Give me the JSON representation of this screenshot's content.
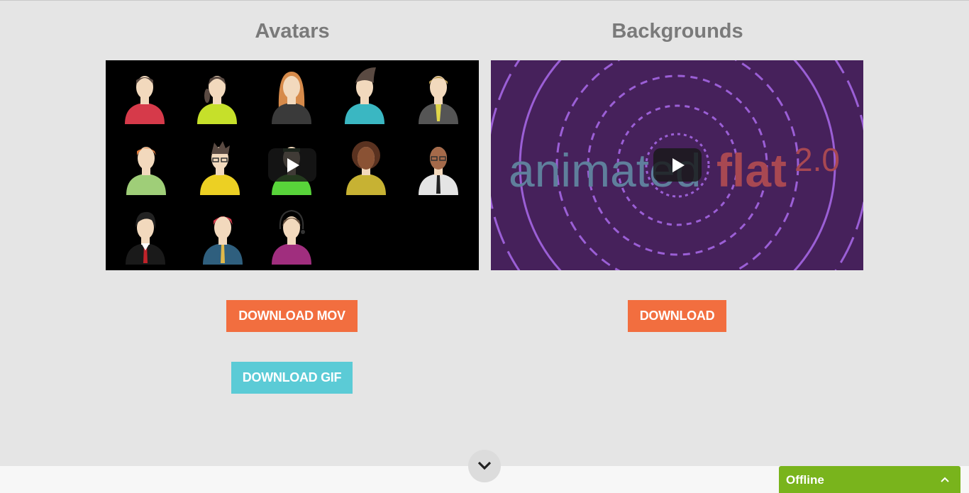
{
  "sections": [
    {
      "title": "Avatars",
      "buttons": [
        {
          "label": "DOWNLOAD MOV",
          "color": "#f26e3f"
        },
        {
          "label": "DOWNLOAD GIF",
          "color": "#5bcbd6"
        }
      ]
    },
    {
      "title": "Backgrounds",
      "video_text": {
        "animated": "animated",
        "flat": "flat",
        "version": "2.0"
      },
      "buttons": [
        {
          "label": "DOWNLOAD",
          "color": "#f26e3f"
        }
      ]
    }
  ],
  "chat": {
    "status": "Offline",
    "color": "#79b41c"
  },
  "colors": {
    "page_bg": "#e5e5e5",
    "video_purple": "#46215b"
  }
}
